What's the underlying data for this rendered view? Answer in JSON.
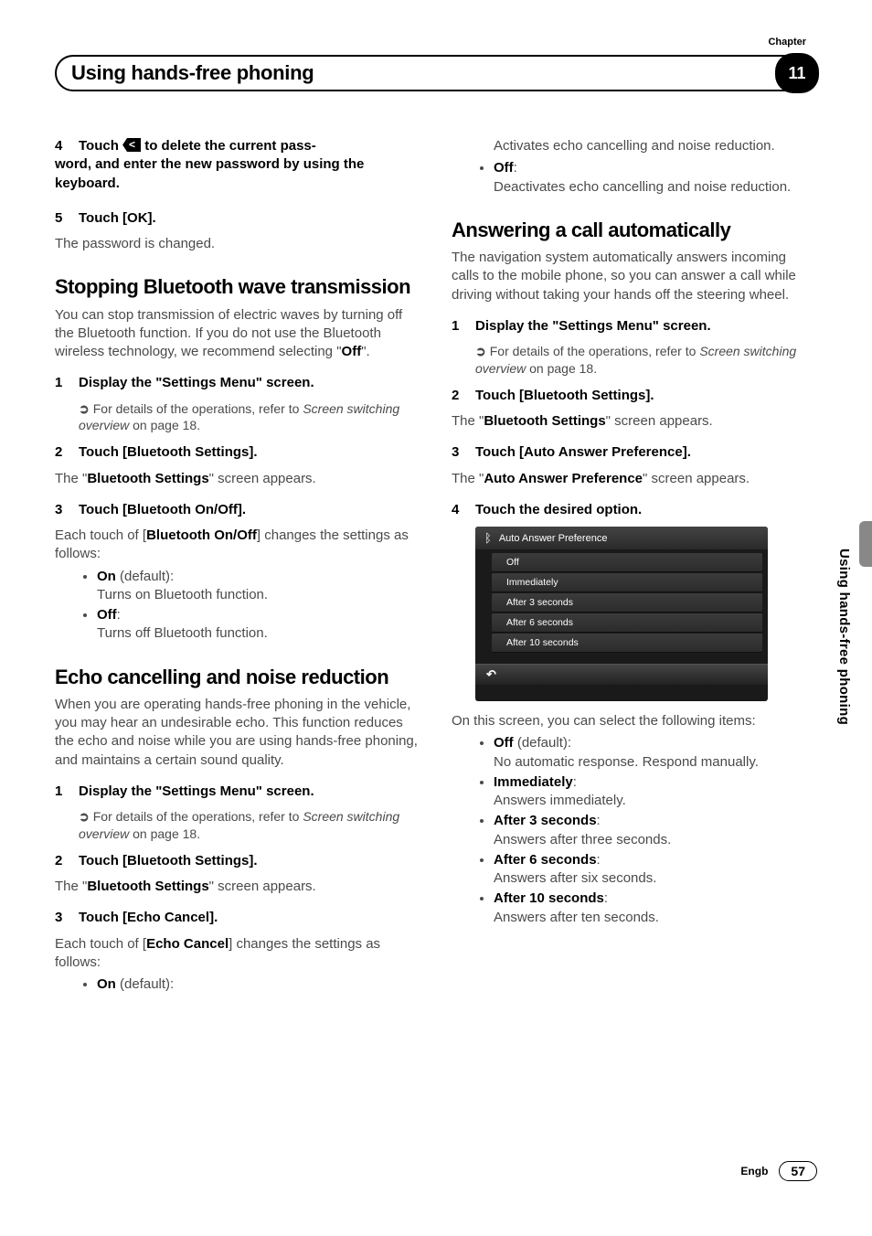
{
  "chapterLabel": "Chapter",
  "chapterNumber": "11",
  "headerTitle": "Using hands-free phoning",
  "sideLabel": "Using hands-free phoning",
  "footer": {
    "lang": "Engb",
    "page": "57"
  },
  "left": {
    "step4": {
      "num": "4",
      "line1a": "Touch ",
      "line1b": " to delete the current pass-",
      "line2": "word, and enter the new password by using the keyboard."
    },
    "step5": {
      "num": "5",
      "title": "Touch [OK].",
      "body": "The password is changed."
    },
    "stopping": {
      "h": "Stopping Bluetooth wave transmission",
      "intro1": "You can stop transmission of electric waves by turning off the Bluetooth function. If you do not use the Bluetooth wireless technology, we recommend selecting \"",
      "introOff": "Off",
      "intro2": "\".",
      "s1": {
        "num": "1",
        "title": "Display the \"Settings Menu\" screen.",
        "ref1": "For details of the operations, refer to ",
        "refItalic": "Screen switching overview",
        "ref2": " on page 18."
      },
      "s2": {
        "num": "2",
        "title": "Touch [Bluetooth Settings].",
        "body1": "The \"",
        "bodyB": "Bluetooth Settings",
        "body2": "\" screen appears."
      },
      "s3": {
        "num": "3",
        "title": "Touch [Bluetooth On/Off].",
        "body1": "Each touch of [",
        "bodyB": "Bluetooth On/Off",
        "body2": "] changes the settings as follows:"
      },
      "bullets": {
        "onTitle": "On",
        "onDefault": " (default):",
        "onDesc": "Turns on Bluetooth function.",
        "offTitle": "Off",
        "offColon": ":",
        "offDesc": "Turns off Bluetooth function."
      }
    },
    "echo": {
      "h": "Echo cancelling and noise reduction",
      "intro": "When you are operating hands-free phoning in the vehicle, you may hear an undesirable echo. This function reduces the echo and noise while you are using hands-free phoning, and maintains a certain sound quality.",
      "s1": {
        "num": "1",
        "title": "Display the \"Settings Menu\" screen.",
        "ref1": "For details of the operations, refer to ",
        "refItalic": "Screen switching overview",
        "ref2": " on page 18."
      },
      "s2": {
        "num": "2",
        "title": "Touch [Bluetooth Settings].",
        "body1": "The \"",
        "bodyB": "Bluetooth Settings",
        "body2": "\" screen appears."
      },
      "s3": {
        "num": "3",
        "title": "Touch [Echo Cancel].",
        "body1": "Each touch of [",
        "bodyB": "Echo Cancel",
        "body2": "] changes the settings as follows:"
      },
      "onTitle": "On",
      "onDefault": " (default):"
    }
  },
  "right": {
    "echoCont": {
      "onDesc": "Activates echo cancelling and noise reduction.",
      "offTitle": "Off",
      "offColon": ":",
      "offDesc": "Deactivates echo cancelling and noise reduction."
    },
    "answering": {
      "h": "Answering a call automatically",
      "intro": "The navigation system automatically answers incoming calls to the mobile phone, so you can answer a call while driving without taking your hands off the steering wheel.",
      "s1": {
        "num": "1",
        "title": "Display the \"Settings Menu\" screen.",
        "ref1": "For details of the operations, refer to ",
        "refItalic": "Screen switching overview",
        "ref2": " on page 18."
      },
      "s2": {
        "num": "2",
        "title": "Touch [Bluetooth Settings].",
        "body1": "The \"",
        "bodyB": "Bluetooth Settings",
        "body2": "\" screen appears."
      },
      "s3": {
        "num": "3",
        "title": "Touch [Auto Answer Preference].",
        "body1": "The \"",
        "bodyB": "Auto Answer Preference",
        "body2": "\" screen appears."
      },
      "s4": {
        "num": "4",
        "title": "Touch the desired option."
      },
      "screenshot": {
        "header": "Auto Answer Preference",
        "rows": [
          "Off",
          "Immediately",
          "After 3 seconds",
          "After 6 seconds",
          "After 10 seconds"
        ]
      },
      "afterShot": "On this screen, you can select the following items:",
      "bullets": [
        {
          "t": "Off",
          "suffix": " (default):",
          "d": "No automatic response. Respond manually."
        },
        {
          "t": "Immediately",
          "suffix": ":",
          "d": "Answers immediately."
        },
        {
          "t": "After 3 seconds",
          "suffix": ":",
          "d": "Answers after three seconds."
        },
        {
          "t": "After 6 seconds",
          "suffix": ":",
          "d": "Answers after six seconds."
        },
        {
          "t": "After 10 seconds",
          "suffix": ":",
          "d": "Answers after ten seconds."
        }
      ]
    }
  }
}
